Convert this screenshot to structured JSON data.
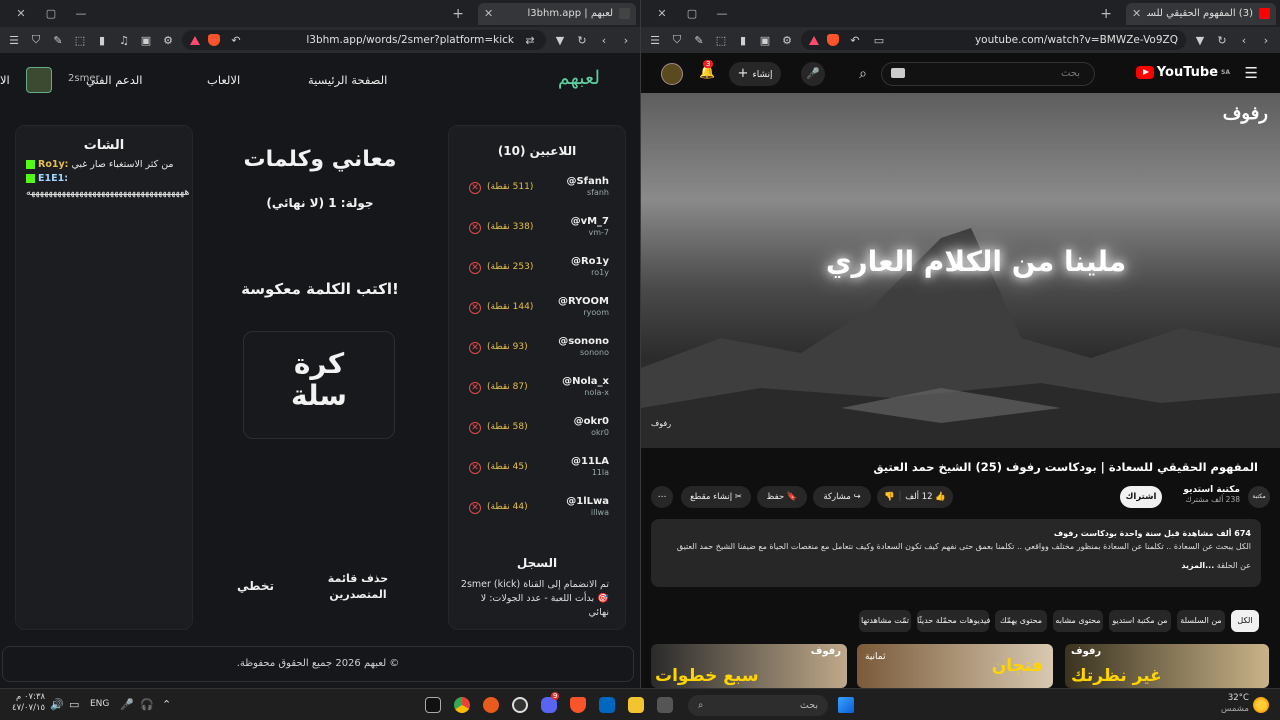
{
  "left_window": {
    "tab_title": "لعبهم | l3bhm.app",
    "url": "l3bhm.app/words/2smer?platform=kick",
    "window_controls": [
      "✕",
      "▢",
      "—"
    ],
    "site": {
      "logo": "لعبهم",
      "nav": [
        "الصفحة الرئيسية",
        "الالعاب",
        "الدعم الفني",
        "الا"
      ],
      "username": "2smer",
      "players_card": {
        "title": "اللاعبين (10)",
        "players": [
          {
            "name": "@Sfanh",
            "handle": "sfanh",
            "points": "(511 نقطة)"
          },
          {
            "name": "@vM_7",
            "handle": "vm-7",
            "points": "(338 نقطة)"
          },
          {
            "name": "@Ro1y",
            "handle": "ro1y",
            "points": "(253 نقطة)"
          },
          {
            "name": "@RYOOM",
            "handle": "ryoom",
            "points": "(144 نقطة)"
          },
          {
            "name": "@sonono",
            "handle": "sonono",
            "points": "(93 نقطة)"
          },
          {
            "name": "@Nola_x",
            "handle": "nola-x",
            "points": "(87 نقطة)"
          },
          {
            "name": "@okr0",
            "handle": "okr0",
            "points": "(58 نقطة)"
          },
          {
            "name": "@11LA",
            "handle": "11la",
            "points": "(45 نقطة)"
          },
          {
            "name": "@1lLwa",
            "handle": "illwa",
            "points": "(44 نقطة)"
          }
        ],
        "log_title": "السجل",
        "log_text": "تم الانضمام إلى القناة 2smer (kick) 🎯 بدأت اللعبة - عدد الجولات: لا نهائي"
      },
      "game_card": {
        "title": "معاني وكلمات",
        "round": "جولة: 1 (لا نهائي)",
        "prompt": "اكتب الكلمة معكوسة!",
        "word_line1": "كرة",
        "word_line2": "سلة",
        "skip_button": "تخطي",
        "clear_button": "حذف قائمة المتصدرين"
      },
      "chat_card": {
        "title": "الشات",
        "messages": [
          {
            "user": "Ro1y:",
            "text": "من كثر الاستغباء صار غبي"
          },
          {
            "user": "E1E1:",
            "text": "ههههههههههههههههههههههههههههههههههههه"
          }
        ]
      },
      "footer": "© لعبهم 2026 جميع الحقوق محفوظة."
    }
  },
  "right_window": {
    "tab_title": "(3) المفهوم الحقيقي للسعادة | بود",
    "url": "youtube.com/watch?v=BMWZe-Vo9ZQ",
    "window_controls": [
      "✕",
      "▢",
      "—"
    ],
    "youtube": {
      "logo": "YouTube",
      "logo_sup": "SA",
      "search_placeholder": "بحث",
      "create_label": "إنشاء",
      "notif_count": "3",
      "video_overlay_text": "ملينا من الكلام العاري",
      "video_brand": "رفوف",
      "title": "المفهوم الحقيقي للسعادة | بودكاست رفوف (25) الشيخ حمد العتيق",
      "channel_name": "مكتبة استديو",
      "channel_subs": "238 ألف مشترك",
      "channel_icon_label": "مكتبة",
      "subscribe": "اشتراك",
      "likes": "12 ألف",
      "share": "مشاركة",
      "save": "حفظ",
      "clip": "إنشاء مقطع",
      "desc_meta": "674 ألف مشاهدة  قبل سنة واحدة  بودكاست رفوف",
      "desc_text": "الكل يبحث عن السعادة .. تكلمنا عن السعادة بمنظور مختلف وواقعي .. تكلمنا بعمق حتى نفهم كيف تكون السعادة وكيف نتعامل مع منغصات الحياة مع ضيفنا الشيخ حمد العتيق",
      "desc_episode": "عن الحلقة",
      "desc_more": "...المزيد",
      "chips": [
        "الكل",
        "من السلسلة",
        "من مكتبة استديو",
        "محتوى مشابه",
        "محتوى يهمّك",
        "فيديوهات محمّلة حديثًا",
        "تمّت مشاهدتها"
      ],
      "thumbs": [
        {
          "text": "غير نظرتك",
          "brand": "رفوف"
        },
        {
          "text": "فنجان",
          "sub": "ثمانية"
        },
        {
          "text": "سبع خطوات",
          "brand": "رفوف"
        }
      ]
    }
  },
  "taskbar": {
    "time": "٠٧:٣٨ م",
    "date": "٤٧/٠٧/١٥",
    "lang": "ENG",
    "search": "بحث",
    "weather_temp": "32°C",
    "weather_label": "مشمس",
    "discord_badge": "9"
  },
  "colors": {
    "accent_green": "#5fd0a0",
    "points_gold": "#e5c04a",
    "delete_red": "#e24b4b",
    "youtube_red": "#ff0000",
    "kick_green": "#53fc18"
  }
}
